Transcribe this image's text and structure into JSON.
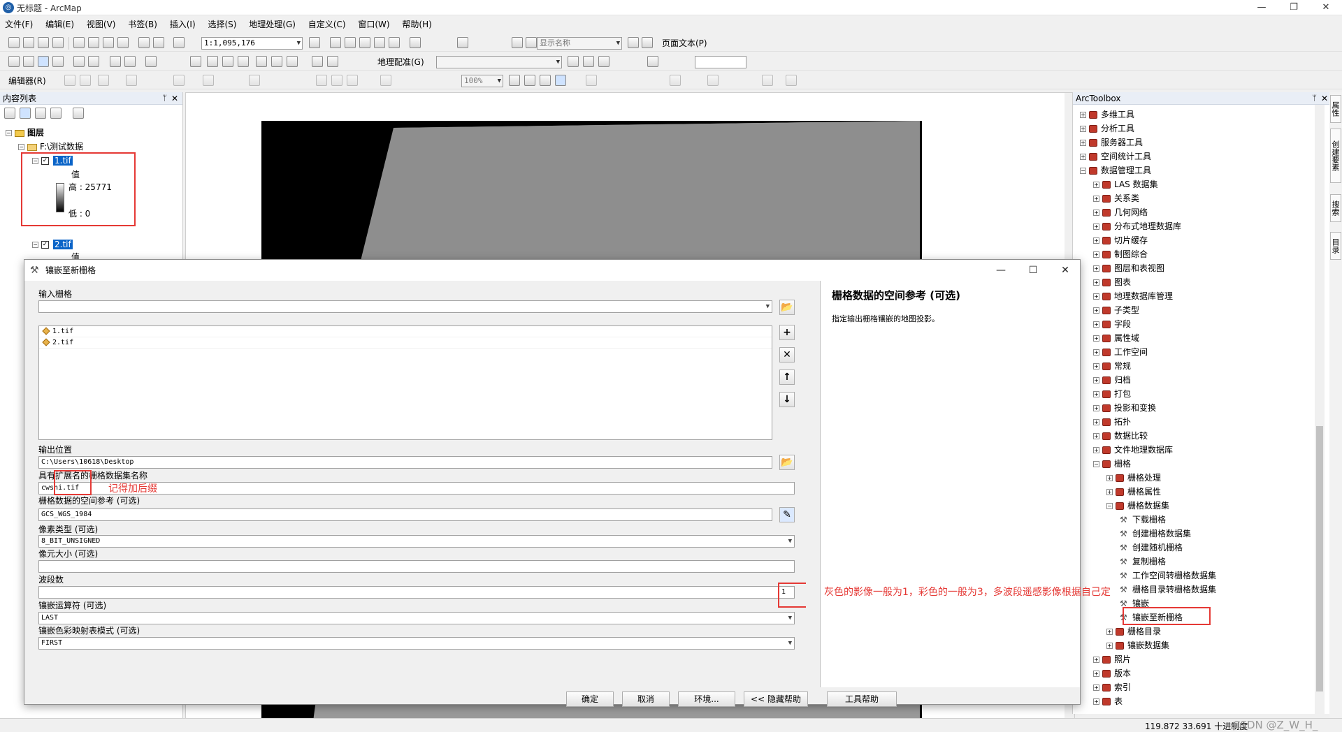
{
  "window": {
    "title": "无标题 - ArcMap",
    "controls": [
      "—",
      "❐",
      "✕"
    ]
  },
  "menu": [
    "文件(F)",
    "编辑(E)",
    "视图(V)",
    "书签(B)",
    "插入(I)",
    "选择(S)",
    "地理处理(G)",
    "自定义(C)",
    "窗口(W)",
    "帮助(H)"
  ],
  "toolbars": {
    "scale": "1:1,095,176",
    "display_name": "显示名称",
    "page_text": "页面文本(P)",
    "georef": "地理配准(G)",
    "editor": "编辑器(R)",
    "zoom": "100%"
  },
  "toc": {
    "title": "内容列表",
    "root": "图层",
    "folder": "F:\\测试数据",
    "layer1": {
      "name": "1.tif",
      "value_label": "值",
      "high": "高 : 25771",
      "low": "低 : 0"
    },
    "layer2": {
      "name": "2.tif",
      "value_label": "值"
    }
  },
  "toolbox": {
    "title": "ArcToolbox",
    "items": [
      {
        "label": "多维工具",
        "level": 0,
        "exp": "+"
      },
      {
        "label": "分析工具",
        "level": 0,
        "exp": "+"
      },
      {
        "label": "服务器工具",
        "level": 0,
        "exp": "+"
      },
      {
        "label": "空间统计工具",
        "level": 0,
        "exp": "+"
      },
      {
        "label": "数据管理工具",
        "level": 0,
        "exp": "−"
      },
      {
        "label": "LAS 数据集",
        "level": 1,
        "exp": "+"
      },
      {
        "label": "关系类",
        "level": 1,
        "exp": "+"
      },
      {
        "label": "几何网络",
        "level": 1,
        "exp": "+"
      },
      {
        "label": "分布式地理数据库",
        "level": 1,
        "exp": "+"
      },
      {
        "label": "切片缓存",
        "level": 1,
        "exp": "+"
      },
      {
        "label": "制图综合",
        "level": 1,
        "exp": "+"
      },
      {
        "label": "图层和表视图",
        "level": 1,
        "exp": "+"
      },
      {
        "label": "图表",
        "level": 1,
        "exp": "+"
      },
      {
        "label": "地理数据库管理",
        "level": 1,
        "exp": "+"
      },
      {
        "label": "子类型",
        "level": 1,
        "exp": "+"
      },
      {
        "label": "字段",
        "level": 1,
        "exp": "+"
      },
      {
        "label": "属性域",
        "level": 1,
        "exp": "+"
      },
      {
        "label": "工作空间",
        "level": 1,
        "exp": "+"
      },
      {
        "label": "常规",
        "level": 1,
        "exp": "+"
      },
      {
        "label": "归档",
        "level": 1,
        "exp": "+"
      },
      {
        "label": "打包",
        "level": 1,
        "exp": "+"
      },
      {
        "label": "投影和变换",
        "level": 1,
        "exp": "+"
      },
      {
        "label": "拓扑",
        "level": 1,
        "exp": "+"
      },
      {
        "label": "数据比较",
        "level": 1,
        "exp": "+"
      },
      {
        "label": "文件地理数据库",
        "level": 1,
        "exp": "+"
      },
      {
        "label": "栅格",
        "level": 1,
        "exp": "−"
      },
      {
        "label": "栅格处理",
        "level": 2,
        "exp": "+"
      },
      {
        "label": "栅格属性",
        "level": 2,
        "exp": "+"
      },
      {
        "label": "栅格数据集",
        "level": 2,
        "exp": "−"
      },
      {
        "label": "下载栅格",
        "level": 3,
        "exp": ""
      },
      {
        "label": "创建栅格数据集",
        "level": 3,
        "exp": ""
      },
      {
        "label": "创建随机栅格",
        "level": 3,
        "exp": ""
      },
      {
        "label": "复制栅格",
        "level": 3,
        "exp": ""
      },
      {
        "label": "工作空间转栅格数据集",
        "level": 3,
        "exp": ""
      },
      {
        "label": "栅格目录转栅格数据集",
        "level": 3,
        "exp": ""
      },
      {
        "label": "镶嵌",
        "level": 3,
        "exp": ""
      },
      {
        "label": "镶嵌至新栅格",
        "level": 3,
        "exp": ""
      },
      {
        "label": "栅格目录",
        "level": 2,
        "exp": "+"
      },
      {
        "label": "镶嵌数据集",
        "level": 2,
        "exp": "+"
      },
      {
        "label": "照片",
        "level": 1,
        "exp": "+"
      },
      {
        "label": "版本",
        "level": 1,
        "exp": "+"
      },
      {
        "label": "索引",
        "level": 1,
        "exp": "+"
      },
      {
        "label": "表",
        "level": 1,
        "exp": "+"
      }
    ]
  },
  "right_dock": {
    "tab1": "属性",
    "tab2": "创建要素",
    "tab3": "搜索",
    "tab4": "目录"
  },
  "dialog": {
    "title": "镶嵌至新栅格",
    "input_label": "输入栅格",
    "inputs": [
      "1.tif",
      "2.tif"
    ],
    "output_loc_label": "输出位置",
    "output_loc_value": "C:\\Users\\10618\\Desktop",
    "name_label": "具有扩展名的栅格数据集名称",
    "name_value": "cwshi.tif",
    "sr_label": "栅格数据的空间参考 (可选)",
    "sr_value": "GCS_WGS_1984",
    "pixel_label": "像素类型 (可选)",
    "pixel_value": "8_BIT_UNSIGNED",
    "cell_label": "像元大小 (可选)",
    "cell_value": "",
    "bands_label": "波段数",
    "bands_value": "1",
    "operator_label": "镶嵌运算符 (可选)",
    "operator_value": "LAST",
    "colormap_label": "镶嵌色彩映射表模式 (可选)",
    "colormap_value": "FIRST",
    "buttons": {
      "ok": "确定",
      "cancel": "取消",
      "env": "环境...",
      "hide_help": "<< 隐藏帮助",
      "tool_help": "工具帮助"
    },
    "help_title": "栅格数据的空间参考 (可选)",
    "help_text": "指定输出栅格镶嵌的地图投影。"
  },
  "annotations": {
    "suffix": "记得加后缀",
    "bands": "灰色的影像一般为1，彩色的一般为3，多波段遥感影像根据自己定"
  },
  "status": {
    "coords": "119.872  33.691 十进制度",
    "watermark": "CSDN @Z_W_H_"
  }
}
